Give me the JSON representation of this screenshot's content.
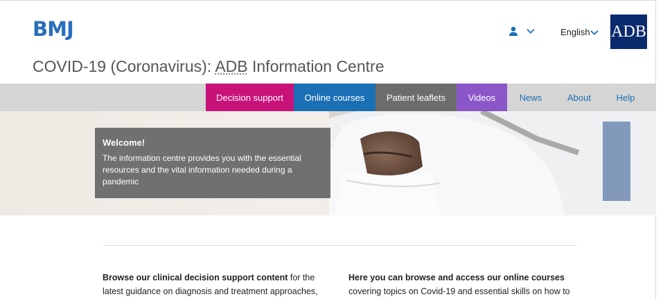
{
  "header": {
    "logo": "BMJ",
    "language": "English",
    "partner_logo": "ADB"
  },
  "title": {
    "prefix": "COVID-19 (Coronavirus): ",
    "abbr": "ADB",
    "suffix": " Information Centre"
  },
  "nav": {
    "decision_support": "Decision support",
    "online_courses": "Online courses",
    "patient_leaflets": "Patient leaflets",
    "videos": "Videos",
    "news": "News",
    "about": "About",
    "help": "Help"
  },
  "welcome": {
    "title": "Welcome!",
    "text": "The information centre provides you with the essential resources and the vital information needed during a pandemic"
  },
  "content": {
    "left_bold": "Browse our clinical decision support content",
    "left_rest": " for the latest guidance on diagnosis and treatment approaches,",
    "right_bold": "Here you can browse and access our online courses",
    "right_rest": " covering topics on Covid-19 and essential skills on how to"
  },
  "colors": {
    "brand_blue": "#2a6ebb",
    "decision": "#c8127a",
    "courses": "#1a6fb5",
    "leaflets": "#6c6c6c",
    "videos": "#8a56c8",
    "adb_navy": "#0a2a6e"
  }
}
